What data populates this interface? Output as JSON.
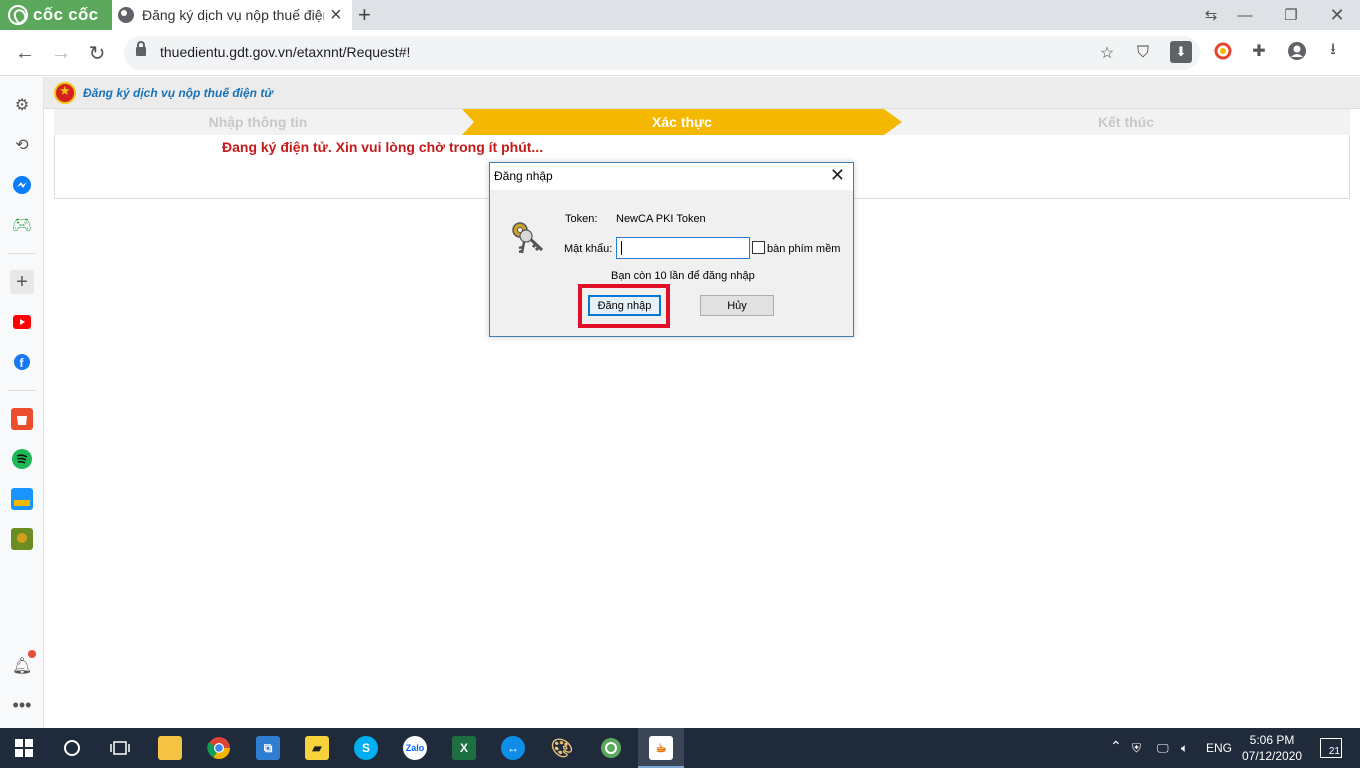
{
  "browser": {
    "brand_name": "cốc cốc",
    "tab_title": "Đăng ký dịch vụ nộp thuế điện tử",
    "new_tab": "+",
    "url": "thuedientu.gdt.gov.vn/etaxnnt/Request#!"
  },
  "page": {
    "header_title": "Đăng ký dịch vụ nộp thuế điện tử",
    "steps": [
      {
        "label": "Nhập thông tin",
        "state": "done"
      },
      {
        "label": "Xác thực",
        "state": "active"
      },
      {
        "label": "Kết thúc",
        "state": "pending"
      }
    ],
    "wait_message": "Đang ký điện tử. Xin vui lòng chờ trong ít phút..."
  },
  "dialog": {
    "title": "Đăng nhập",
    "token_label": "Token:",
    "token_value": "NewCA PKI Token",
    "password_label": "Mật khẩu:",
    "password_value": "",
    "virtual_keyboard_label": "bàn phím mềm",
    "virtual_keyboard_checked": false,
    "attempts_text": "Bạn còn 10 lần để đăng nhập",
    "login_button": "Đăng nhập",
    "cancel_button": "Hủy"
  },
  "taskbar": {
    "language": "ENG",
    "time": "5:06 PM",
    "date": "07/12/2020",
    "notification_count": "21",
    "apps": [
      "start",
      "search",
      "task-view",
      "file-explorer",
      "chrome",
      "remote-desktop",
      "sticky-notes",
      "skype",
      "zalo",
      "excel",
      "teamviewer",
      "paint",
      "coccoc",
      "java"
    ]
  },
  "colors": {
    "brand_green": "#5ba85c",
    "step_active": "#f5b800",
    "error_red": "#c41a1a",
    "highlight_red": "#e0102a",
    "title_blue": "#1a73b8"
  }
}
